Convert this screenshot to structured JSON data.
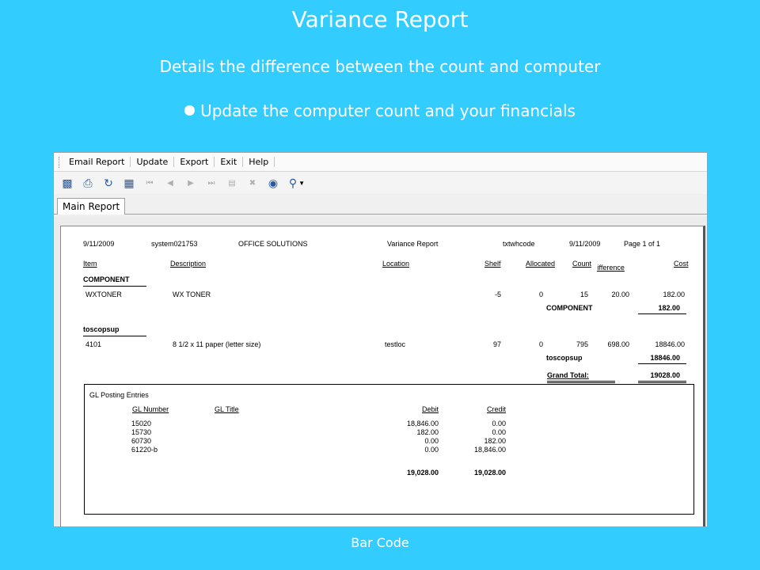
{
  "slide": {
    "title": "Variance Report",
    "subtitle": "Details the difference  between the count and computer",
    "bullet": "Update the computer count and your financials",
    "footer": "Bar Code"
  },
  "menu": [
    "Email Report",
    "Update",
    "Export",
    "Exit",
    "Help"
  ],
  "toolbar": {
    "icons": [
      "export-icon",
      "print-icon",
      "refresh-icon",
      "group-tree-icon",
      "first-page-icon",
      "prev-page-icon",
      "next-page-icon",
      "last-page-icon",
      "goto-page-icon",
      "stop-icon",
      "find-icon",
      "zoom-icon"
    ]
  },
  "tab": "Main Report",
  "report": {
    "header": {
      "date": "9/11/2009",
      "system": "system021753",
      "company": "OFFICE SOLUTIONS",
      "title": "Variance Report",
      "user": "txtwhcode",
      "date2": "9/11/2009",
      "page": "Page 1 of 1"
    },
    "columns": {
      "item": "Item",
      "description": "Description",
      "location": "Location",
      "shelf": "Shelf",
      "allocated": "Allocated",
      "count": "Count",
      "difference": "Difference",
      "cost": "Cost"
    },
    "groups": [
      {
        "name": "COMPONENT",
        "row": {
          "item": "WXTONER",
          "description": "WX TONER",
          "location": "",
          "shelf": "-5",
          "allocated": "0",
          "count": "15",
          "difference": "20.00",
          "cost": "182.00"
        },
        "subtotal_label": "COMPONENT",
        "subtotal": "182.00"
      },
      {
        "name": "toscopsup",
        "row": {
          "item": "4101",
          "description": "8 1/2 x 11 paper (letter size)",
          "location": "testloc",
          "shelf": "97",
          "allocated": "0",
          "count": "795",
          "difference": "698.00",
          "cost": "18846.00"
        },
        "subtotal_label": "toscopsup",
        "subtotal": "18846.00"
      }
    ],
    "grand_total_label": "Grand Total:",
    "grand_total": "19028.00",
    "gl": {
      "title": "GL Posting Entries",
      "headers": {
        "number": "GL Number",
        "title": "GL Title",
        "debit": "Debit",
        "credit": "Credit"
      },
      "rows": [
        {
          "number": "15020",
          "debit": "18,846.00",
          "credit": "0.00"
        },
        {
          "number": "15730",
          "debit": "182.00",
          "credit": "0.00"
        },
        {
          "number": "60730",
          "debit": "0.00",
          "credit": "182.00"
        },
        {
          "number": "61220-b",
          "debit": "0.00",
          "credit": "18,846.00"
        }
      ],
      "total_debit": "19,028.00",
      "total_credit": "19,028.00"
    }
  }
}
